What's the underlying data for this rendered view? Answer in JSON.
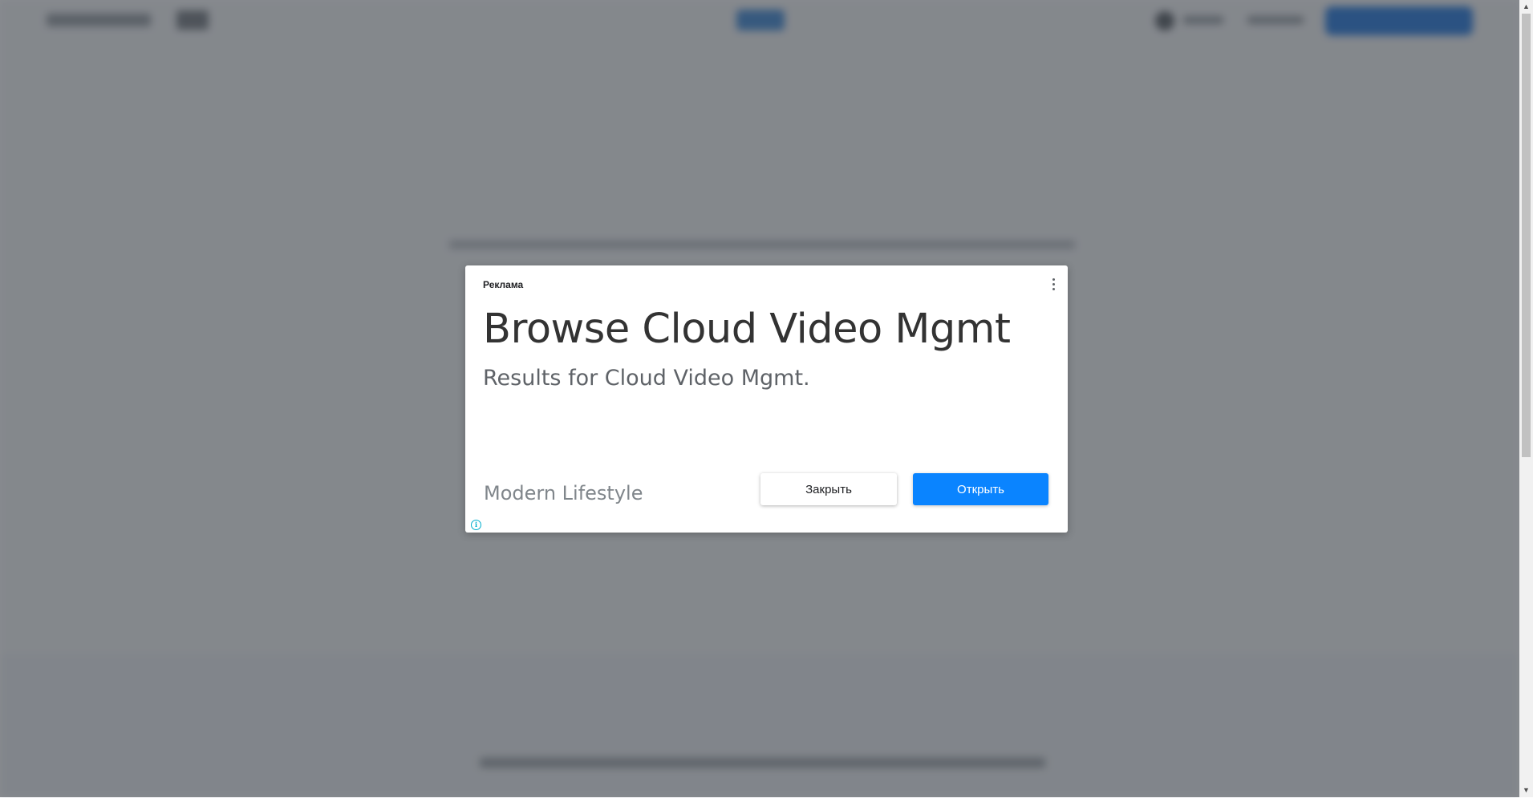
{
  "ad": {
    "label": "Реклама",
    "headline": "Browse Cloud Video Mgmt",
    "description": "Results for Cloud Video Mgmt.",
    "advertiser": "Modern Lifestyle",
    "close_label": "Закрыть",
    "open_label": "Открыть",
    "menu_icon": "more-vert-icon",
    "info_icon": "info-icon",
    "info_glyph": "i"
  },
  "scrollbar": {
    "up_arrow": "▲",
    "down_arrow": "▼"
  },
  "colors": {
    "open_button": "#0a84ff",
    "info_icon": "#00aecd",
    "overlay": "rgba(40, 45, 52, 0.55)"
  }
}
